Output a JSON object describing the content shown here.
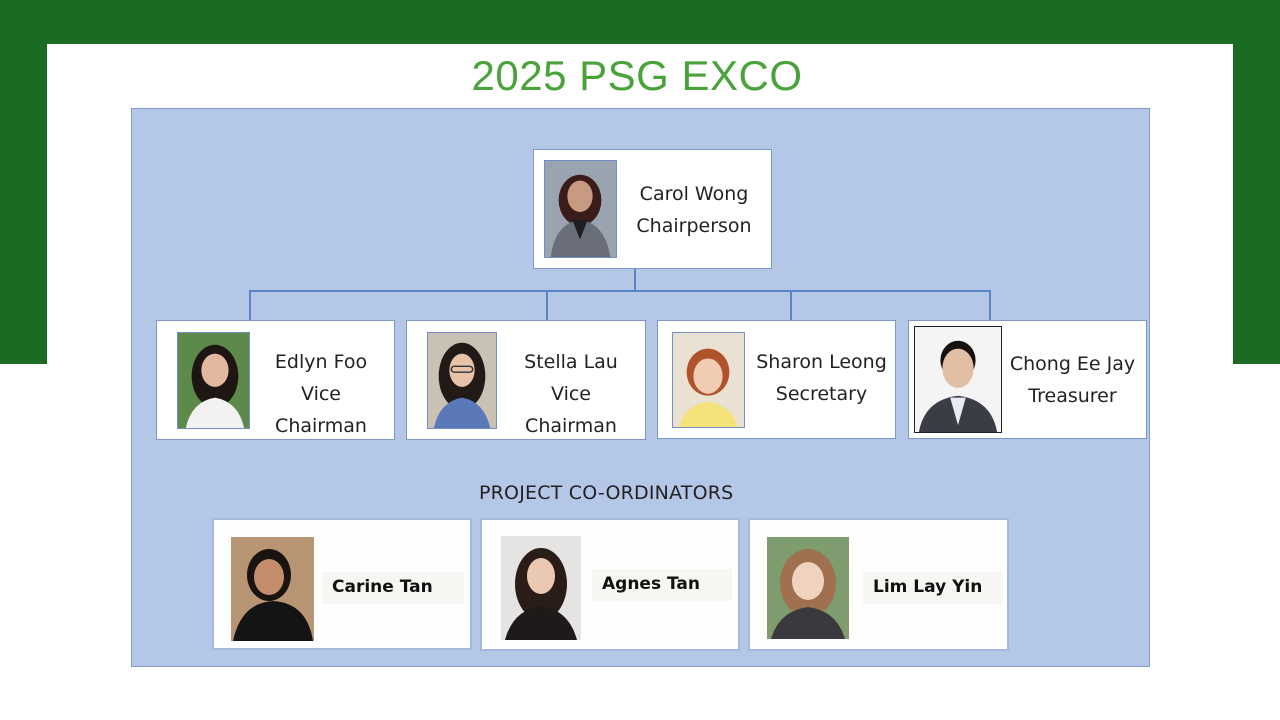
{
  "slide": {
    "title": "2025 PSG EXCO",
    "section_label": "PROJECT CO-ORDINATORS",
    "colors": {
      "band": "#1b6b22",
      "title": "#4aa33a",
      "panel": "#b4c7e7",
      "connector": "#5b84c4"
    }
  },
  "chair": {
    "name": "Carol Wong",
    "role": "Chairperson"
  },
  "officers": [
    {
      "name": "Edlyn Foo",
      "role": "Vice Chairman"
    },
    {
      "name": "Stella Lau",
      "role": "Vice Chairman"
    },
    {
      "name": "Sharon Leong",
      "role": "Secretary"
    },
    {
      "name": "Chong Ee Jay",
      "role": "Treasurer"
    }
  ],
  "coordinators": [
    {
      "name": "Carine Tan"
    },
    {
      "name": "Agnes Tan"
    },
    {
      "name": "Lim Lay Yin"
    }
  ]
}
